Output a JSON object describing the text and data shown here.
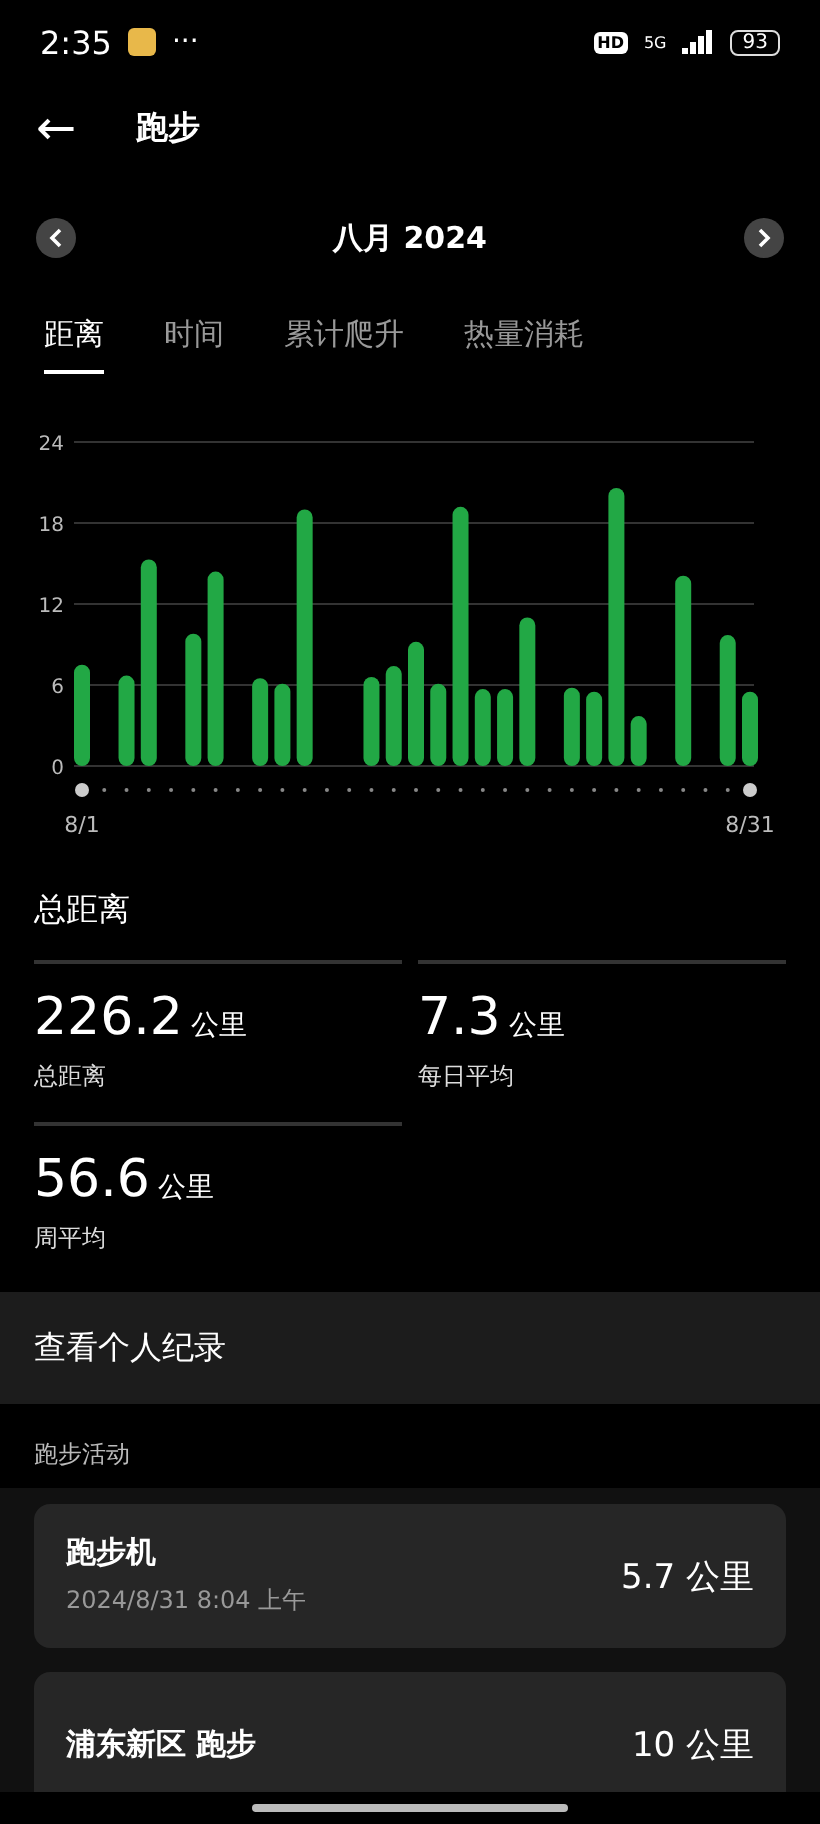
{
  "status_bar": {
    "time": "2:35",
    "more": "···",
    "hd": "HD",
    "network": "5G",
    "battery": "93"
  },
  "header": {
    "back": "←",
    "title": "跑步"
  },
  "month_nav": {
    "label": "八月 2024"
  },
  "tabs": [
    {
      "label": "距离",
      "selected": true
    },
    {
      "label": "时间",
      "selected": false
    },
    {
      "label": "累计爬升",
      "selected": false
    },
    {
      "label": "热量消耗",
      "selected": false
    }
  ],
  "chart_data": {
    "type": "bar",
    "categories": [
      "8/1",
      null,
      null,
      null,
      null,
      null,
      null,
      null,
      null,
      null,
      null,
      null,
      null,
      null,
      null,
      null,
      null,
      null,
      null,
      null,
      null,
      null,
      null,
      null,
      null,
      null,
      null,
      null,
      null,
      null,
      "8/31"
    ],
    "series": [
      {
        "color": "#22a845",
        "values": [
          7.5,
          null,
          6.7,
          15.3,
          null,
          9.8,
          14.4,
          null,
          6.5,
          6.1,
          19.0,
          null,
          null,
          6.6,
          7.4,
          9.2,
          6.1,
          19.2,
          5.7,
          5.7,
          11.0,
          null,
          5.8,
          5.5,
          20.6,
          3.7,
          null,
          14.1,
          null,
          9.7,
          5.5
        ]
      }
    ],
    "ylim": [
      0,
      24
    ],
    "yticks": [
      0,
      6,
      12,
      18,
      24
    ],
    "grid": true
  },
  "summary": {
    "title": "总距离",
    "stats": [
      {
        "value": "226.2",
        "unit": "公里",
        "label": "总距离"
      },
      {
        "value": "7.3",
        "unit": "公里",
        "label": "每日平均"
      },
      {
        "value": "56.6",
        "unit": "公里",
        "label": "周平均"
      }
    ]
  },
  "records_link": "查看个人纪录",
  "activities": {
    "title": "跑步活动",
    "items": [
      {
        "name": "跑步机",
        "date": "2024/8/31 8:04 上午",
        "distance": "5.7 公里"
      },
      {
        "name": "浦东新区 跑步",
        "distance": "10 公里"
      }
    ]
  }
}
